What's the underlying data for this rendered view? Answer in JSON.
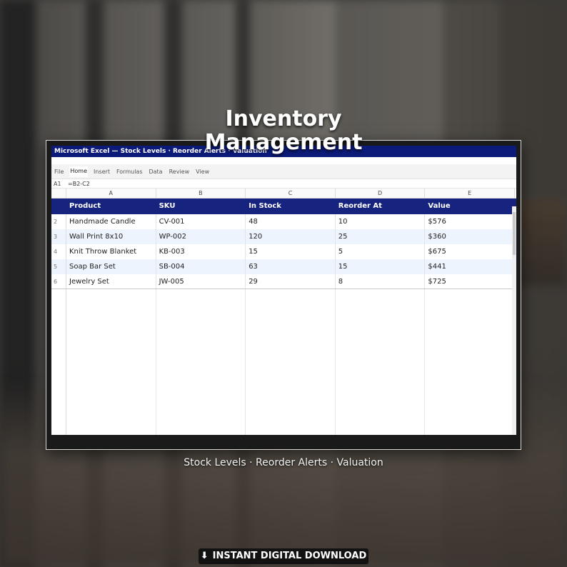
{
  "hero": {
    "title_line1": "Inventory",
    "title_line2": "Management"
  },
  "window": {
    "title": "Microsoft Excel  —  Stock Levels · Reorder Alerts · Valuation",
    "tabs": [
      "File",
      "Home",
      "Insert",
      "Formulas",
      "Data",
      "Review",
      "View"
    ],
    "active_tab": "Home",
    "formula_bar": {
      "cell_ref": "A1",
      "formula": "=B2-C2"
    },
    "columns": [
      "A",
      "B",
      "C",
      "D",
      "E"
    ],
    "header_row": {
      "row_number": "",
      "cells": [
        "Product",
        "SKU",
        "In Stock",
        "Reorder At",
        "Value"
      ]
    },
    "rows": [
      {
        "row_number": "2",
        "cells": [
          "Handmade Candle",
          "CV-001",
          "48",
          "10",
          "$576"
        ]
      },
      {
        "row_number": "3",
        "cells": [
          "Wall Print 8x10",
          "WP-002",
          "120",
          "25",
          "$360"
        ]
      },
      {
        "row_number": "4",
        "cells": [
          "Knit Throw Blanket",
          "KB-003",
          "15",
          "5",
          "$675"
        ]
      },
      {
        "row_number": "5",
        "cells": [
          "Soap Bar Set",
          "SB-004",
          "63",
          "15",
          "$441"
        ]
      },
      {
        "row_number": "6",
        "cells": [
          "Jewelry Set",
          "JW-005",
          "29",
          "8",
          "$725"
        ]
      }
    ],
    "colors": {
      "title_bar": "#0c1a7a",
      "header_row": "#16237f",
      "alt_row": "#eef4fd"
    }
  },
  "subtitle": "Stock Levels · Reorder Alerts · Valuation",
  "download": {
    "icon": "download-icon",
    "label": "INSTANT DIGITAL DOWNLOAD"
  }
}
